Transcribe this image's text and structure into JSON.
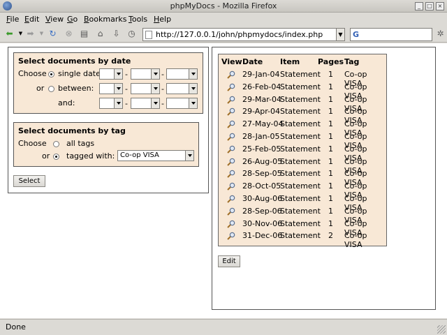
{
  "window": {
    "title": "phpMyDocs - Mozilla Firefox"
  },
  "menu": [
    "File",
    "Edit",
    "View",
    "Go",
    "Bookmarks",
    "Tools",
    "Help"
  ],
  "address": {
    "url": "http://127.0.0.1/john/phpmydocs/index.php",
    "search_value": ""
  },
  "date_form": {
    "heading": "Select documents by date",
    "choose_label": "Choose",
    "single_date_label": "single date:",
    "or_label": "or",
    "between_label": "between:",
    "and_label": "and:",
    "separator": "-"
  },
  "tag_form": {
    "heading": "Select documents by tag",
    "choose_label": "Choose",
    "all_tags_label": "all tags",
    "or_label": "or",
    "tagged_with_label": "tagged with:",
    "tag_value": "Co-op VISA"
  },
  "select_button": "Select",
  "edit_button": "Edit",
  "table": {
    "headers": [
      "View",
      "Date",
      "Item",
      "Pages",
      "Tag"
    ],
    "rows": [
      {
        "date": "29-Jan-04",
        "item": "Statement",
        "pages": "1",
        "tag": "Co-op VISA"
      },
      {
        "date": "26-Feb-04",
        "item": "Statement",
        "pages": "1",
        "tag": "Co-op VISA"
      },
      {
        "date": "29-Mar-04",
        "item": "Statement",
        "pages": "1",
        "tag": "Co-op VISA"
      },
      {
        "date": "29-Apr-04",
        "item": "Statement",
        "pages": "1",
        "tag": "Co-op VISA"
      },
      {
        "date": "27-May-04",
        "item": "Statement",
        "pages": "1",
        "tag": "Co-op VISA"
      },
      {
        "date": "28-Jan-05",
        "item": "Statement",
        "pages": "1",
        "tag": "Co-op VISA"
      },
      {
        "date": "25-Feb-05",
        "item": "Statement",
        "pages": "1",
        "tag": "Co-op VISA"
      },
      {
        "date": "26-Aug-05",
        "item": "Statement",
        "pages": "1",
        "tag": "Co-op VISA"
      },
      {
        "date": "28-Sep-05",
        "item": "Statement",
        "pages": "1",
        "tag": "Co-op VISA"
      },
      {
        "date": "28-Oct-05",
        "item": "Statement",
        "pages": "1",
        "tag": "Co-op VISA"
      },
      {
        "date": "30-Aug-06",
        "item": "Statement",
        "pages": "1",
        "tag": "Co-op VISA"
      },
      {
        "date": "28-Sep-06",
        "item": "Statement",
        "pages": "1",
        "tag": "Co-op VISA"
      },
      {
        "date": "30-Nov-06",
        "item": "Statement",
        "pages": "1",
        "tag": "Co-op VISA"
      },
      {
        "date": "31-Dec-06",
        "item": "Statement",
        "pages": "2",
        "tag": "Co-op VISA"
      }
    ]
  },
  "status": "Done",
  "icons": {
    "view": "magnifier-icon",
    "back": "back-arrow-icon",
    "forward": "forward-arrow-icon",
    "reload": "reload-icon",
    "stop": "stop-icon",
    "print": "print-icon",
    "home": "home-icon",
    "history": "history-icon"
  }
}
